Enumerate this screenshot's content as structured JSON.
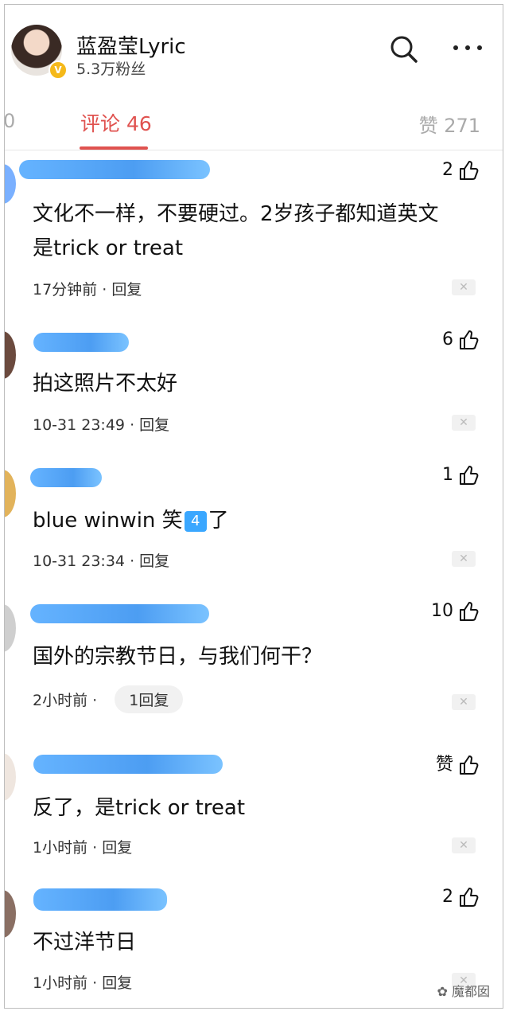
{
  "header": {
    "name": "蓝盈莹Lyric",
    "fans": "5.3万粉丝",
    "search_icon": "search-icon",
    "more_icon": "more-icon"
  },
  "tabs": {
    "left_partial": "0",
    "active": "评论 46",
    "right": "赞 271"
  },
  "comments": [
    {
      "likes": "2",
      "text_line1": "文化不一样，不要硬过。2岁孩子都知道英文",
      "text_line2": "是trick or treat",
      "time": "17分钟前",
      "reply": "回复"
    },
    {
      "likes": "6",
      "text_line1": "拍这照片不太好",
      "time": "10-31 23:49",
      "reply": "回复"
    },
    {
      "likes": "1",
      "text_before": "blue winwin 笑",
      "emoji": "4",
      "text_after": "了",
      "time": "10-31 23:34",
      "reply": "回复"
    },
    {
      "likes": "10",
      "text_line1": "国外的宗教节日，与我们何干？",
      "time": "2小时前",
      "reply": "1回复"
    },
    {
      "likes": "赞",
      "text_line1": "反了，是trick or treat",
      "time": "1小时前",
      "reply": "回复"
    },
    {
      "likes": "2",
      "text_line1": "不过洋节日",
      "time": "1小时前",
      "reply": "回复"
    }
  ],
  "close_label": "✕",
  "watermark": "魔都囡"
}
